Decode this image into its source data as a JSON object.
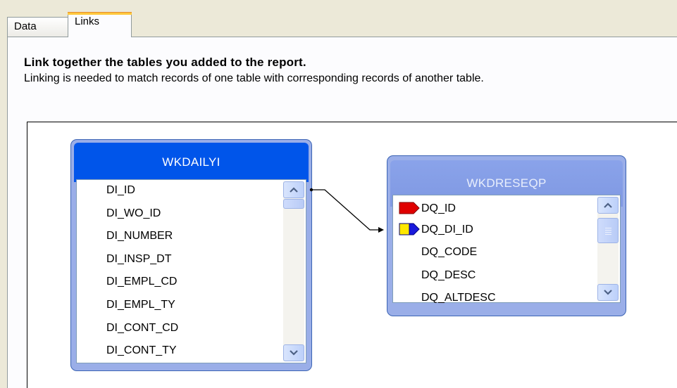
{
  "tabs": {
    "data_label": "Data",
    "links_label": "Links"
  },
  "instructions": {
    "heading": "Link together the tables you added to the report.",
    "subtext": "Linking is needed to match records of one table with corresponding records of another table."
  },
  "tables": {
    "left": {
      "title": "WKDAILYI",
      "fields": [
        "DI_ID",
        "DI_WO_ID",
        "DI_NUMBER",
        "DI_INSP_DT",
        "DI_EMPL_CD",
        "DI_EMPL_TY",
        "DI_CONT_CD",
        "DI_CONT_TY"
      ]
    },
    "right": {
      "title": "WKDRESEQP",
      "fields": [
        "DQ_ID",
        "DQ_DI_ID",
        "DQ_CODE",
        "DQ_DESC",
        "DQ_ALTDESC"
      ],
      "key_icons": [
        "red-key-icon",
        "yellow-blue-key-icon"
      ]
    }
  },
  "link": {
    "from": "WKDAILYI.DI_ID",
    "to": "WKDRESEQP.DQ_DI_ID"
  },
  "colors": {
    "active_title": "#0055ea",
    "inactive_title": "#8aa3ea",
    "tab_highlight": "#ffc83c",
    "primary_key": "#e00000",
    "foreign_key": "#ffe800"
  }
}
